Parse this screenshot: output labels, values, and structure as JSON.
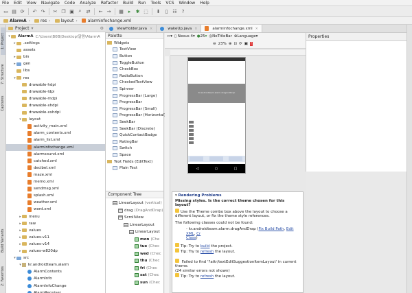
{
  "menubar": [
    "File",
    "Edit",
    "View",
    "Navigate",
    "Code",
    "Analyze",
    "Refactor",
    "Build",
    "Run",
    "Tools",
    "VCS",
    "Window",
    "Help"
  ],
  "breadcrumb": [
    "AlarmA",
    "res",
    "layout",
    "alarminfochange.xml"
  ],
  "project_panel": {
    "title": "Project",
    "root": "AlarmA",
    "root_path": "C:\\Users\\B0B\\Desktop\\알람\\AlarmA"
  },
  "tree": [
    {
      "label": ".settings",
      "type": "folder",
      "indent": 1,
      "toggle": "▸"
    },
    {
      "label": "assets",
      "type": "folder",
      "indent": 1,
      "toggle": ""
    },
    {
      "label": "bin",
      "type": "folder",
      "indent": 1,
      "toggle": "▸"
    },
    {
      "label": "gen",
      "type": "src",
      "indent": 1,
      "toggle": "▸"
    },
    {
      "label": "libs",
      "type": "folder",
      "indent": 1,
      "toggle": ""
    },
    {
      "label": "res",
      "type": "folder",
      "indent": 1,
      "toggle": "▾"
    },
    {
      "label": "drawable-hdpi",
      "type": "folder",
      "indent": 2,
      "toggle": ""
    },
    {
      "label": "drawable-ldpi",
      "type": "folder",
      "indent": 2,
      "toggle": ""
    },
    {
      "label": "drawable-mdpi",
      "type": "folder",
      "indent": 2,
      "toggle": ""
    },
    {
      "label": "drawable-xhdpi",
      "type": "folder",
      "indent": 2,
      "toggle": ""
    },
    {
      "label": "drawable-xxhdpi",
      "type": "folder",
      "indent": 2,
      "toggle": ""
    },
    {
      "label": "layout",
      "type": "folder",
      "indent": 2,
      "toggle": "▾"
    },
    {
      "label": "activity_main.xml",
      "type": "xml",
      "indent": 3,
      "toggle": ""
    },
    {
      "label": "alarm_contents.xml",
      "type": "xml",
      "indent": 3,
      "toggle": ""
    },
    {
      "label": "alarm_list.xml",
      "type": "xml",
      "indent": 3,
      "toggle": ""
    },
    {
      "label": "alarminfochange.xml",
      "type": "xml",
      "indent": 3,
      "toggle": "",
      "selected": true
    },
    {
      "label": "alarmsound.xml",
      "type": "xml",
      "indent": 3,
      "toggle": ""
    },
    {
      "label": "catched.xml",
      "type": "xml",
      "indent": 3,
      "toggle": ""
    },
    {
      "label": "decibel.xml",
      "type": "xml",
      "indent": 3,
      "toggle": ""
    },
    {
      "label": "maze.xml",
      "type": "xml",
      "indent": 3,
      "toggle": ""
    },
    {
      "label": "memo.xml",
      "type": "xml",
      "indent": 3,
      "toggle": ""
    },
    {
      "label": "sendmsg.xml",
      "type": "xml",
      "indent": 3,
      "toggle": ""
    },
    {
      "label": "splash.xml",
      "type": "xml",
      "indent": 3,
      "toggle": ""
    },
    {
      "label": "weather.xml",
      "type": "xml",
      "indent": 3,
      "toggle": ""
    },
    {
      "label": "word.xml",
      "type": "xml",
      "indent": 3,
      "toggle": ""
    },
    {
      "label": "menu",
      "type": "folder",
      "indent": 2,
      "toggle": "▸"
    },
    {
      "label": "raw",
      "type": "folder",
      "indent": 2,
      "toggle": "▸"
    },
    {
      "label": "values",
      "type": "folder",
      "indent": 2,
      "toggle": "▸"
    },
    {
      "label": "values-v11",
      "type": "folder",
      "indent": 2,
      "toggle": "▸"
    },
    {
      "label": "values-v14",
      "type": "folder",
      "indent": 2,
      "toggle": "▸"
    },
    {
      "label": "values-w820dp",
      "type": "folder",
      "indent": 2,
      "toggle": "▸"
    },
    {
      "label": "src",
      "type": "src",
      "indent": 1,
      "toggle": "▾"
    },
    {
      "label": "kr.androidteam.alarm",
      "type": "pkg",
      "indent": 2,
      "toggle": "▾"
    },
    {
      "label": "AlarmContents",
      "type": "java",
      "indent": 3,
      "toggle": ""
    },
    {
      "label": "AlarmInfo",
      "type": "java",
      "indent": 3,
      "toggle": ""
    },
    {
      "label": "AlarmInfoChange",
      "type": "java",
      "indent": 3,
      "toggle": ""
    },
    {
      "label": "AlarmReceiver",
      "type": "java",
      "indent": 3,
      "toggle": ""
    }
  ],
  "side_tabs_left": [
    "1: Project",
    "7: Structure",
    "Captures",
    "Build Variants",
    "2: Favorites"
  ],
  "editor_tabs": [
    {
      "label": "ViewHolder.java",
      "active": false
    },
    {
      "label": "wakeUp.java",
      "active": false
    },
    {
      "label": "alarminfochange.xml",
      "active": true
    }
  ],
  "palette": {
    "title": "Palette",
    "items": [
      {
        "label": "Widgets",
        "kind": "group"
      },
      {
        "label": "TextView",
        "kind": "item"
      },
      {
        "label": "Button",
        "kind": "item"
      },
      {
        "label": "ToggleButton",
        "kind": "item"
      },
      {
        "label": "CheckBox",
        "kind": "item"
      },
      {
        "label": "RadioButton",
        "kind": "item"
      },
      {
        "label": "CheckedTextView",
        "kind": "item"
      },
      {
        "label": "Spinner",
        "kind": "item"
      },
      {
        "label": "ProgressBar (Large)",
        "kind": "item"
      },
      {
        "label": "ProgressBar",
        "kind": "item"
      },
      {
        "label": "ProgressBar (Small)",
        "kind": "item"
      },
      {
        "label": "ProgressBar (Horizontal)",
        "kind": "item"
      },
      {
        "label": "SeekBar",
        "kind": "item"
      },
      {
        "label": "SeekBar (Discrete)",
        "kind": "item"
      },
      {
        "label": "QuickContactBadge",
        "kind": "item"
      },
      {
        "label": "RatingBar",
        "kind": "item"
      },
      {
        "label": "Switch",
        "kind": "item"
      },
      {
        "label": "Space",
        "kind": "item"
      },
      {
        "label": "Text Fields (EditText)",
        "kind": "group"
      },
      {
        "label": "Plain Text",
        "kind": "item"
      }
    ]
  },
  "component_tree": {
    "title": "Component Tree",
    "rows": [
      {
        "label": "LinearLayout",
        "note": "(vertical)",
        "icon": "lin",
        "indent": 1
      },
      {
        "label": "drag",
        "note": "(DragAndDrap)",
        "icon": "lin",
        "indent": 2
      },
      {
        "label": "ScrollView",
        "note": "",
        "icon": "lin",
        "indent": 2
      },
      {
        "label": "LinearLayout",
        "note": "",
        "icon": "lin",
        "indent": 3
      },
      {
        "label": "LinearLayout",
        "note": "",
        "icon": "lin",
        "indent": 4
      },
      {
        "label": "mon",
        "note": "(Che",
        "icon": "chk",
        "indent": 5
      },
      {
        "label": "tue",
        "note": "(Chec",
        "icon": "chk",
        "indent": 5
      },
      {
        "label": "wed",
        "note": "(Chec",
        "icon": "chk",
        "indent": 5
      },
      {
        "label": "thu",
        "note": "(Chec",
        "icon": "chk",
        "indent": 5
      },
      {
        "label": "fri",
        "note": "(Chec",
        "icon": "chk",
        "indent": 5
      },
      {
        "label": "sat",
        "note": "(Chec",
        "icon": "chk",
        "indent": 5
      },
      {
        "label": "sun",
        "note": "(Chec",
        "icon": "chk",
        "indent": 5
      }
    ]
  },
  "canvas_toolbar": {
    "device": "Nexus 4",
    "api": "25",
    "theme": "NoTitleBar",
    "language": "Language",
    "zoom": "23%"
  },
  "properties": {
    "title": "Properties"
  },
  "preview": {
    "title_text": "Kr.androidteam.alarm.dragAndDrap"
  },
  "rendering": {
    "title": "Rendering Problems",
    "missing": "Missing styles. Is the correct theme chosen for this layout?",
    "line1": "Use the Theme combo box above the layout to choose a different layout, or fix the theme style references.",
    "line2": "The following classes could not be found:",
    "cls": "- kr.androidteam.alarm.dragAndDrap",
    "fix_build": "Fix Build Path",
    "edit_xml": "Edit XML",
    "cr": "Cr",
    "class_word": "Class",
    "tip": "Tip: Try to",
    "build": "build",
    "build_rest": "the project.",
    "refresh": "refresh",
    "refresh_rest": "the layout.",
    "failed": "Failed to find '?attr/textEditSuggestionItemLayout' in current theme.",
    "errors": "(24 similar errors not shown)"
  }
}
